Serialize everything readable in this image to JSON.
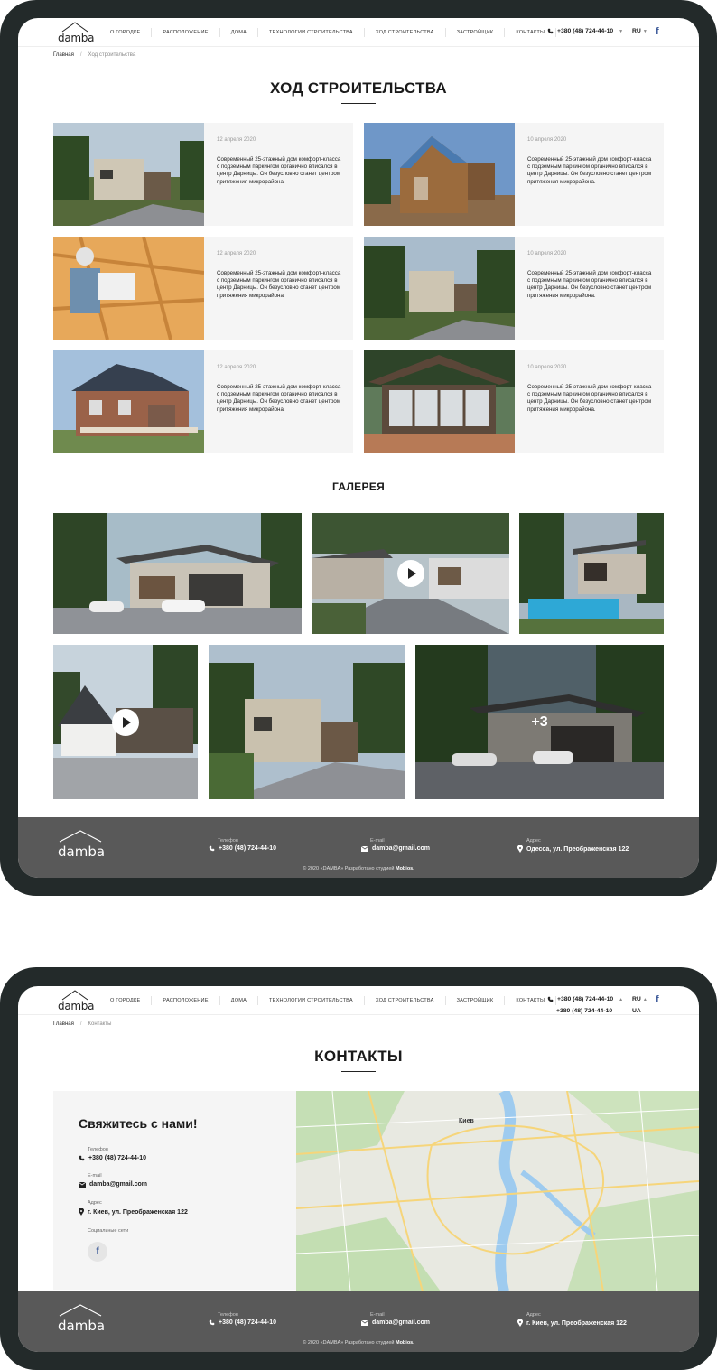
{
  "header": {
    "logo": "damba",
    "nav": [
      "О городке",
      "Расположение",
      "Дома",
      "Технологии строительства",
      "Ход строительства",
      "Застройщик",
      "Контакты"
    ],
    "phone": "+380 (48) 724-44-10",
    "phone2": "+380 (48) 724-44-10",
    "lang": "RU",
    "lang2": "UA",
    "facebook": "f"
  },
  "page1": {
    "breadcrumb_home": "Главная",
    "breadcrumb_current": "Ход строительства",
    "title": "ХОД СТРОИТЕЛЬСТВА",
    "cards": [
      {
        "date": "12 апреля 2020",
        "text": "Современный 25-этажный дом комфорт-класса с подземным паркингом органично вписался в центр Дарницы. Он безусловно станет центром притяжения микрорайона."
      },
      {
        "date": "10 апреля 2020",
        "text": "Современный 25-этажный дом комфорт-класса с подземным паркингом органично вписался в центр Дарницы. Он безусловно станет центром притяжения микрорайона."
      },
      {
        "date": "12 апреля 2020",
        "text": "Современный 25-этажный дом комфорт-класса с подземным паркингом органично вписался в центр Дарницы. Он безусловно станет центром притяжения микрорайона."
      },
      {
        "date": "10 апреля 2020",
        "text": "Современный 25-этажный дом комфорт-класса с подземным паркингом органично вписался в центр Дарницы. Он безусловно станет центром притяжения микрорайона."
      },
      {
        "date": "12 апреля 2020",
        "text": "Современный 25-этажный дом комфорт-класса с подземным паркингом органично вписался в центр Дарницы. Он безусловно станет центром притяжения микрорайона."
      },
      {
        "date": "10 апреля 2020",
        "text": "Современный 25-этажный дом комфорт-класса с подземным паркингом органично вписался в центр Дарницы. Он безусловно станет центром притяжения микрорайона."
      }
    ],
    "gallery_title": "ГАЛЕРЕЯ",
    "gallery_more": "+3"
  },
  "footer": {
    "logo": "damba",
    "phone_label": "Телефон",
    "phone": "+380 (48) 724-44-10",
    "email_label": "E-mail",
    "email": "damba@gmail.com",
    "address_label": "Адрес",
    "address": "Одесса, ул. Преображенская 122",
    "address2": "г. Киев, ул. Преображенская 122",
    "copyright": "© 2020 «DAMBA» Разработано студией",
    "studio": "Mobios."
  },
  "page2": {
    "breadcrumb_home": "Главная",
    "breadcrumb_current": "Контакты",
    "title": "КОНТАКТЫ",
    "contact_heading": "Свяжитесь с нами!",
    "phone_label": "Телефон",
    "phone": "+380 (48) 724-44-10",
    "email_label": "E-mail",
    "email": "damba@gmail.com",
    "address_label": "Адрес",
    "address": "г. Киев, ул. Преображенская 122",
    "social_label": "Социальные сети",
    "map_city": "Киев"
  },
  "colors": {
    "frame": "#232a2a",
    "footer": "#595959",
    "card": "#f5f5f5",
    "accent_fb": "#3b5998"
  }
}
